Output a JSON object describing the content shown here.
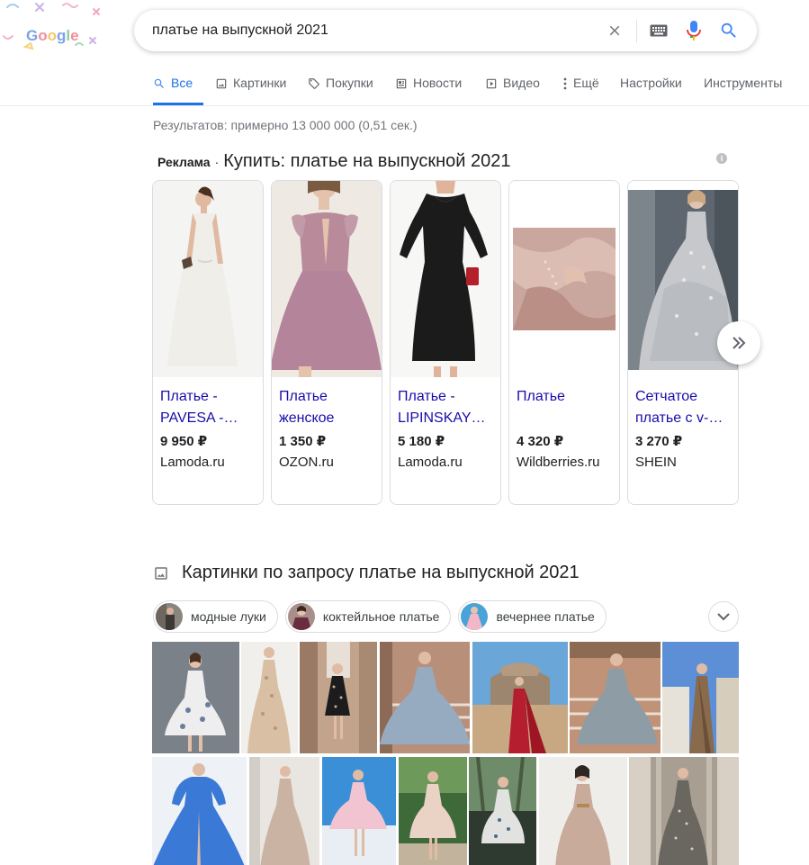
{
  "search": {
    "query": "платье на выпускной 2021"
  },
  "tabs": [
    {
      "label": "Все",
      "icon": "search-icon",
      "active": true
    },
    {
      "label": "Картинки",
      "icon": "image-icon"
    },
    {
      "label": "Покупки",
      "icon": "tag-icon"
    },
    {
      "label": "Новости",
      "icon": "newspaper-icon"
    },
    {
      "label": "Видео",
      "icon": "play-icon"
    },
    {
      "label": "Ещё",
      "icon": "more-vert-icon"
    },
    {
      "label": "Настройки"
    },
    {
      "label": "Инструменты"
    }
  ],
  "result_stats": "Результатов: примерно 13 000 000 (0,51 сек.)",
  "ads": {
    "label": "Реклама",
    "title": "Купить: платье на выпускной 2021",
    "products": [
      {
        "name": "Платье - PAVESA -…",
        "price": "9 950 ₽",
        "store": "Lamoda.ru"
      },
      {
        "name": "Платье женское",
        "price": "1 350 ₽",
        "store": "OZON.ru"
      },
      {
        "name": "Платье - LIPINSKAY…",
        "price": "5 180 ₽",
        "store": "Lamoda.ru"
      },
      {
        "name": "Платье",
        "price": "4 320 ₽",
        "store": "Wildberries.ru"
      },
      {
        "name": "Сетчатое платье с v-…",
        "price": "3 270 ₽",
        "store": "SHEIN"
      }
    ]
  },
  "images_section": {
    "title": "Картинки по запросу платье на выпускной 2021",
    "chips": [
      {
        "label": "модные луки"
      },
      {
        "label": "коктейльное платье"
      },
      {
        "label": "вечернее платье"
      }
    ]
  },
  "colors": {
    "accent": "#1a73e8",
    "link": "#1a0dab",
    "text": "#202124",
    "muted": "#70757a",
    "tab_text": "#5f6368"
  }
}
